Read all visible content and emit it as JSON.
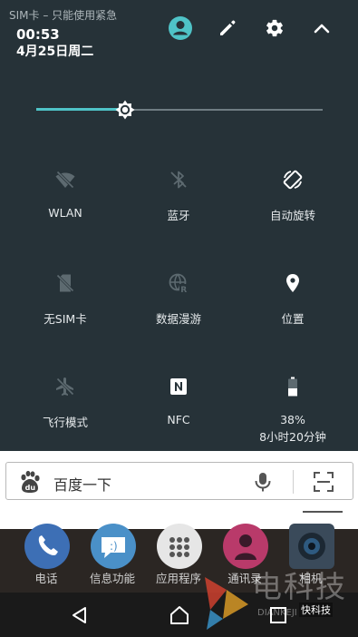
{
  "status": {
    "carrier": "SIM卡 – 只能使用紧急",
    "time": "00:53",
    "date": "4月25日周二"
  },
  "header": {
    "icons": [
      "account-icon",
      "edit-icon",
      "settings-icon",
      "collapse-icon"
    ],
    "account_color": "#4fc3c7"
  },
  "brightness": {
    "level": 0.31,
    "accent": "#4fc3c7"
  },
  "tiles": [
    {
      "label": "WLAN",
      "icon": "wifi-off-icon",
      "state": "off"
    },
    {
      "label": "蓝牙",
      "icon": "bluetooth-off-icon",
      "state": "off"
    },
    {
      "label": "自动旋转",
      "icon": "auto-rotate-icon",
      "state": "on"
    },
    {
      "label": "无SIM卡",
      "icon": "no-sim-icon",
      "state": "off"
    },
    {
      "label": "数据漫游",
      "icon": "roaming-icon",
      "state": "off"
    },
    {
      "label": "位置",
      "icon": "location-icon",
      "state": "on"
    },
    {
      "label": "飞行模式",
      "icon": "airplane-icon",
      "state": "off"
    },
    {
      "label": "NFC",
      "icon": "nfc-icon",
      "state": "on"
    },
    {
      "label": "38%",
      "sublabel": "8小时20分钟",
      "icon": "battery-icon",
      "state": "on"
    }
  ],
  "search": {
    "placeholder": "百度一下",
    "logo": "baidu-du-icon"
  },
  "dock": {
    "apps": [
      {
        "label": "电话",
        "icon": "phone-icon",
        "color": "#3d6fb5"
      },
      {
        "label": "信息功能",
        "icon": "messages-icon",
        "color": "#4a90c8"
      },
      {
        "label": "应用程序",
        "icon": "app-drawer-icon",
        "color": "#e6e6e6"
      },
      {
        "label": "通讯录",
        "icon": "contacts-icon",
        "color": "#b93a6a"
      },
      {
        "label": "相机",
        "icon": "camera-icon",
        "color": "#3a4a5a"
      }
    ]
  },
  "nav": {
    "icons": [
      "back-icon",
      "home-icon",
      "recents-icon"
    ]
  },
  "watermark": {
    "title": "电科技",
    "sub": "DIANKEJI",
    "badge": "快科技"
  }
}
